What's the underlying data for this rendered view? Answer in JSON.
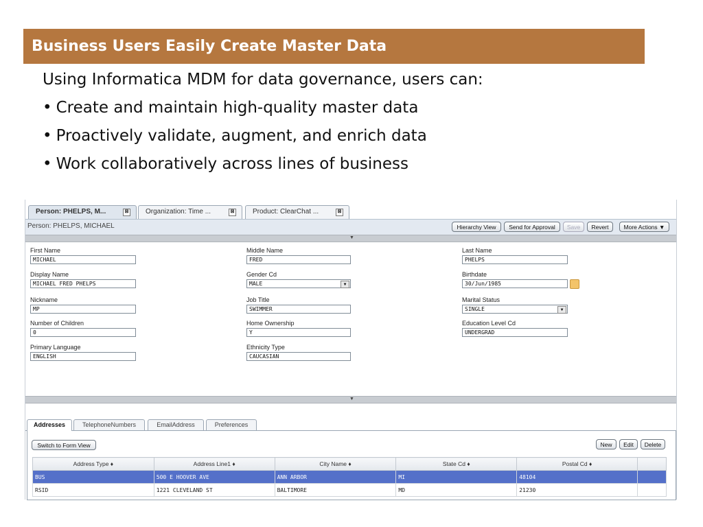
{
  "slide": {
    "title": "Business Users Easily Create Master Data",
    "intro": "Using Informatica MDM for data governance, users can:",
    "bullets": [
      "Create and maintain high-quality master data",
      "Proactively validate, augment, and enrich data",
      "Work collaboratively across lines of business"
    ],
    "bullet_glyph": "•"
  },
  "app": {
    "tabs": [
      {
        "label": "Person: PHELPS, M...",
        "close": "⊠"
      },
      {
        "label": "Organization: Time ...",
        "close": "⊠"
      },
      {
        "label": "Product: ClearChat ...",
        "close": "⊠"
      }
    ],
    "breadcrumb": "Person: PHELPS, MICHAEL",
    "toolbar": {
      "hierarchy_view": "Hierarchy View",
      "send_for_approval": "Send for Approval",
      "save": "Save",
      "revert": "Revert",
      "more_actions": "More Actions ▼"
    },
    "collapse_arrow": "▼",
    "fields": {
      "first_name": {
        "label": "First Name",
        "value": "MICHAEL"
      },
      "middle_name": {
        "label": "Middle Name",
        "value": "FRED"
      },
      "last_name": {
        "label": "Last Name",
        "value": "PHELPS"
      },
      "display_name": {
        "label": "Display Name",
        "value": "MICHAEL FRED PHELPS"
      },
      "gender_cd": {
        "label": "Gender Cd",
        "value": "MALE"
      },
      "birthdate": {
        "label": "Birthdate",
        "value": "30/Jun/1985"
      },
      "nickname": {
        "label": "Nickname",
        "value": "MP"
      },
      "job_title": {
        "label": "Job Title",
        "value": "SWIMMER"
      },
      "marital_status": {
        "label": "Marital Status",
        "value": "SINGLE"
      },
      "number_of_children": {
        "label": "Number of Children",
        "value": "0"
      },
      "home_ownership": {
        "label": "Home Ownership",
        "value": "Y"
      },
      "education_level_cd": {
        "label": "Education Level Cd",
        "value": "UNDERGRAD"
      },
      "primary_language": {
        "label": "Primary Language",
        "value": "ENGLISH"
      },
      "ethnicity_type": {
        "label": "Ethnicity Type",
        "value": "CAUCASIAN"
      }
    },
    "dropdown_glyph": "▼",
    "subtabs": [
      "Addresses",
      "TelephoneNumbers",
      "EmailAddress",
      "Preferences"
    ],
    "subtoolbar": {
      "switch_form": "Switch to Form View",
      "new": "New",
      "edit": "Edit",
      "delete": "Delete"
    },
    "grid": {
      "columns": [
        "Address Type ♦",
        "Address Line1 ♦",
        "City Name ♦",
        "State Cd ♦",
        "Postal Cd ♦"
      ],
      "rows": [
        [
          "BUS",
          "500 E HOOVER AVE",
          "ANN ARBOR",
          "MI",
          "48104"
        ],
        [
          "RSID",
          "1221 CLEVELAND ST",
          "BALTIMORE",
          "MD",
          "21230"
        ]
      ]
    }
  }
}
